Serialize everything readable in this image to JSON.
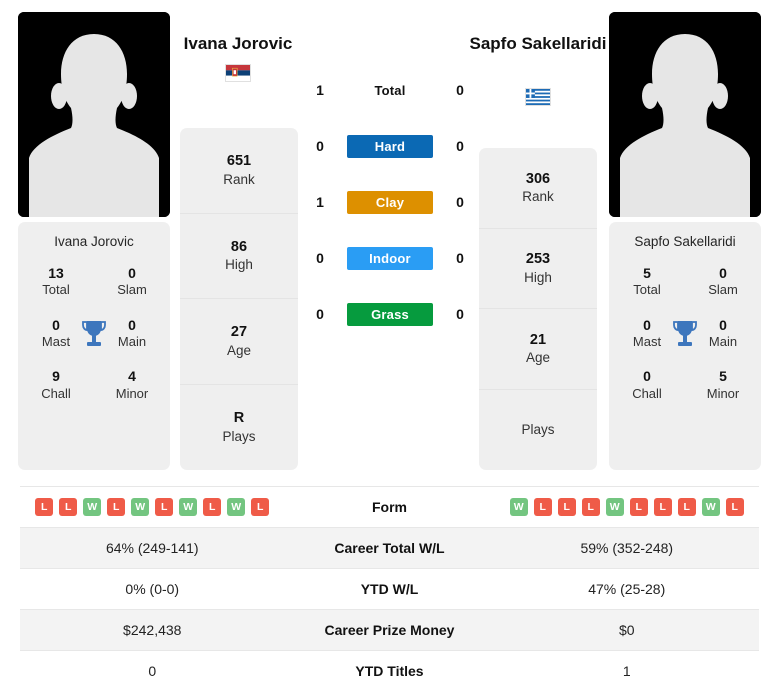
{
  "players": {
    "left": {
      "name": "Ivana Jorovic",
      "flag": "serbia-flag-icon",
      "avatar": "player-avatar-placeholder",
      "titles": {
        "total": "13",
        "total_label": "Total",
        "slam": "0",
        "slam_label": "Slam",
        "mast": "0",
        "mast_label": "Mast",
        "main": "0",
        "main_label": "Main",
        "chall": "9",
        "chall_label": "Chall",
        "minor": "4",
        "minor_label": "Minor"
      },
      "stats": [
        {
          "value": "651",
          "label": "Rank"
        },
        {
          "value": "86",
          "label": "High"
        },
        {
          "value": "27",
          "label": "Age"
        },
        {
          "value": "R",
          "label": "Plays"
        }
      ],
      "form": [
        "L",
        "L",
        "W",
        "L",
        "W",
        "L",
        "W",
        "L",
        "W",
        "L"
      ]
    },
    "right": {
      "name": "Sapfo Sakellaridi",
      "flag": "greece-flag-icon",
      "avatar": "player-avatar-placeholder",
      "titles": {
        "total": "5",
        "total_label": "Total",
        "slam": "0",
        "slam_label": "Slam",
        "mast": "0",
        "mast_label": "Mast",
        "main": "0",
        "main_label": "Main",
        "chall": "0",
        "chall_label": "Chall",
        "minor": "5",
        "minor_label": "Minor"
      },
      "stats": [
        {
          "value": "306",
          "label": "Rank"
        },
        {
          "value": "253",
          "label": "High"
        },
        {
          "value": "21",
          "label": "Age"
        },
        {
          "value": "",
          "label": "Plays"
        }
      ],
      "form": [
        "W",
        "L",
        "L",
        "L",
        "W",
        "L",
        "L",
        "L",
        "W",
        "L"
      ]
    }
  },
  "head_to_head": [
    {
      "label": "Total",
      "left": "1",
      "right": "0",
      "color": "",
      "style": "plain"
    },
    {
      "label": "Hard",
      "left": "0",
      "right": "0",
      "color": "#0b69b4",
      "style": "pill"
    },
    {
      "label": "Clay",
      "left": "1",
      "right": "0",
      "color": "#dd9000",
      "style": "pill"
    },
    {
      "label": "Indoor",
      "left": "0",
      "right": "0",
      "color": "#2a9df4",
      "style": "pill"
    },
    {
      "label": "Grass",
      "left": "0",
      "right": "0",
      "color": "#069b3e",
      "style": "pill"
    }
  ],
  "comparison_table": [
    {
      "label": "Form",
      "left": "",
      "right": "",
      "type": "form"
    },
    {
      "label": "Career Total W/L",
      "left": "64% (249-141)",
      "right": "59% (352-248)",
      "type": "text"
    },
    {
      "label": "YTD W/L",
      "left": "0% (0-0)",
      "right": "47% (25-28)",
      "type": "text"
    },
    {
      "label": "Career Prize Money",
      "left": "$242,438",
      "right": "$0",
      "type": "text"
    },
    {
      "label": "YTD Titles",
      "left": "0",
      "right": "1",
      "type": "text"
    }
  ],
  "colors": {
    "win_badge": "#73c580",
    "loss_badge": "#ef5b48",
    "trophy": "#3d76bd",
    "card_bg": "#efefef"
  }
}
